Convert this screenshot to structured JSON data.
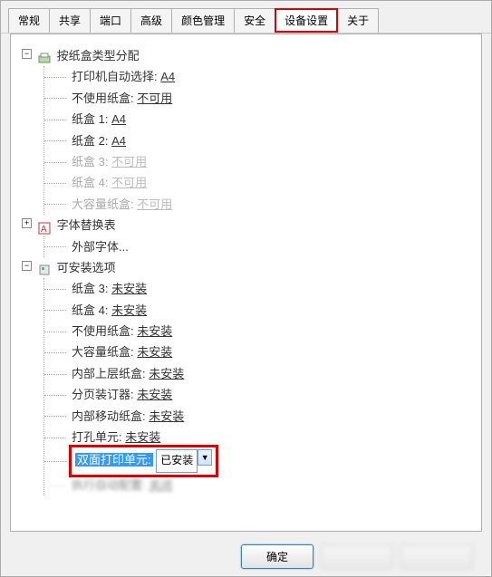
{
  "tabs": [
    "常规",
    "共享",
    "端口",
    "高级",
    "颜色管理",
    "安全",
    "设备设置",
    "关于"
  ],
  "active_tab_index": 6,
  "tree": {
    "section1": {
      "title": "按纸盒类型分配",
      "items": [
        {
          "label": "打印机自动选择:",
          "value": "A4",
          "disabled": false
        },
        {
          "label": "不使用纸盒:",
          "value": "不可用",
          "disabled": false
        },
        {
          "label": "纸盒 1:",
          "value": "A4",
          "disabled": false
        },
        {
          "label": "纸盒 2:",
          "value": "A4",
          "disabled": false
        },
        {
          "label": "纸盒 3:",
          "value": "不可用",
          "disabled": true
        },
        {
          "label": "纸盒 4:",
          "value": "不可用",
          "disabled": true
        },
        {
          "label": "大容量纸盒:",
          "value": "不可用",
          "disabled": true
        }
      ]
    },
    "section2": {
      "title": "字体替换表",
      "items": [
        {
          "label": "外部字体...",
          "value": "",
          "disabled": false
        }
      ]
    },
    "section3": {
      "title": "可安装选项",
      "items": [
        {
          "label": "纸盒 3:",
          "value": "未安装",
          "disabled": false
        },
        {
          "label": "纸盒 4:",
          "value": "未安装",
          "disabled": false
        },
        {
          "label": "不使用纸盒:",
          "value": "未安装",
          "disabled": false
        },
        {
          "label": "大容量纸盒:",
          "value": "未安装",
          "disabled": false
        },
        {
          "label": "内部上层纸盒:",
          "value": "未安装",
          "disabled": false
        },
        {
          "label": "分页装订器:",
          "value": "未安装",
          "disabled": false
        },
        {
          "label": "内部移动纸盒:",
          "value": "未安装",
          "disabled": false
        },
        {
          "label": "打孔单元:",
          "value": "未安装",
          "disabled": false
        }
      ],
      "selected": {
        "label": "双面打印单元:",
        "value": "已安装"
      },
      "trailing": {
        "label": "执行自动配置:",
        "value": "关闭"
      }
    }
  },
  "buttons": {
    "ok": "确定"
  },
  "icons": {
    "toggle_minus": "−",
    "toggle_plus": "+"
  }
}
